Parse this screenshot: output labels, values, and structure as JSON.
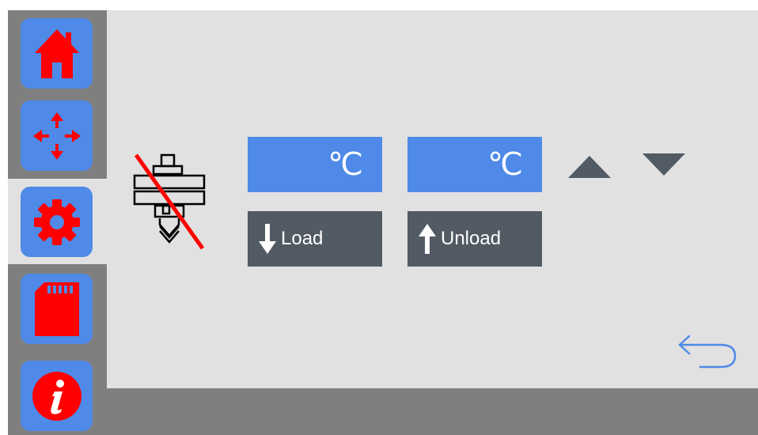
{
  "sidebar": {
    "items": [
      {
        "name": "home",
        "icon": "home-icon"
      },
      {
        "name": "move",
        "icon": "move-arrows-icon"
      },
      {
        "name": "settings",
        "icon": "gear-icon",
        "selected": true
      },
      {
        "name": "sd-card",
        "icon": "sd-card-icon"
      },
      {
        "name": "info",
        "icon": "info-icon"
      }
    ]
  },
  "filament": {
    "extruder_icon": "extruder-disabled-icon",
    "temp_left": "℃",
    "temp_right": "℃",
    "load_label": "Load",
    "unload_label": "Unload",
    "up_icon": "triangle-up-icon",
    "down_icon": "triangle-down-icon"
  },
  "back_icon": "back-arrow-icon",
  "colors": {
    "accent_blue": "#4f8ae8",
    "dark_button": "#525a64",
    "icon_red": "#ff0000",
    "background": "#e1e1e1",
    "frame_gray": "#7f7f7f"
  }
}
